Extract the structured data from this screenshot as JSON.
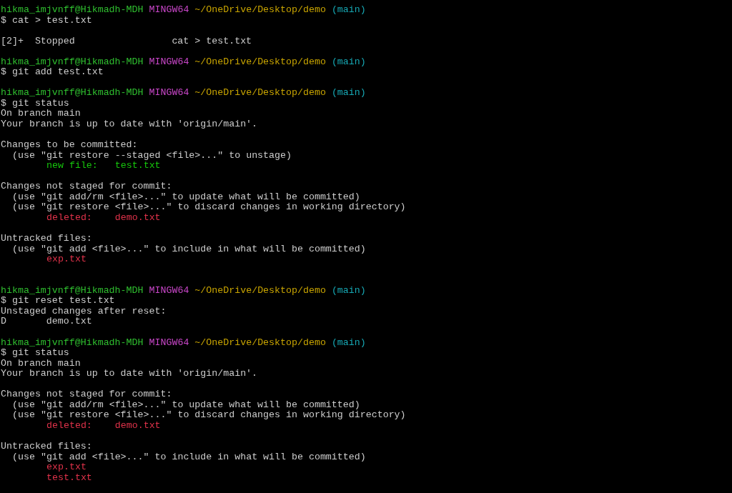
{
  "terminal": {
    "lines": [
      {
        "kind": "prompt",
        "user": "hikma_imjvnff@Hikmadh-MDH",
        "shell": "MINGW64",
        "path": "~/OneDrive/Desktop/demo",
        "branch": "(main)"
      },
      {
        "kind": "command",
        "text": "$ cat > test.txt"
      },
      {
        "kind": "blank"
      },
      {
        "kind": "text",
        "text": "[2]+  Stopped                 cat > test.txt"
      },
      {
        "kind": "blank"
      },
      {
        "kind": "prompt",
        "user": "hikma_imjvnff@Hikmadh-MDH",
        "shell": "MINGW64",
        "path": "~/OneDrive/Desktop/demo",
        "branch": "(main)"
      },
      {
        "kind": "command",
        "text": "$ git add test.txt"
      },
      {
        "kind": "blank"
      },
      {
        "kind": "prompt",
        "user": "hikma_imjvnff@Hikmadh-MDH",
        "shell": "MINGW64",
        "path": "~/OneDrive/Desktop/demo",
        "branch": "(main)"
      },
      {
        "kind": "command",
        "text": "$ git status"
      },
      {
        "kind": "text",
        "text": "On branch main"
      },
      {
        "kind": "text",
        "text": "Your branch is up to date with 'origin/main'."
      },
      {
        "kind": "blank"
      },
      {
        "kind": "text",
        "text": "Changes to be committed:"
      },
      {
        "kind": "hint",
        "text": "(use \"git restore --staged <file>...\" to unstage)"
      },
      {
        "kind": "entry",
        "text": "new file:   test.txt",
        "color": "#16c60c"
      },
      {
        "kind": "blank"
      },
      {
        "kind": "text",
        "text": "Changes not staged for commit:"
      },
      {
        "kind": "hint",
        "text": "(use \"git add/rm <file>...\" to update what will be committed)"
      },
      {
        "kind": "hint",
        "text": "(use \"git restore <file>...\" to discard changes in working directory)"
      },
      {
        "kind": "entry",
        "text": "deleted:    demo.txt",
        "color": "#e0324a"
      },
      {
        "kind": "blank"
      },
      {
        "kind": "text",
        "text": "Untracked files:"
      },
      {
        "kind": "hint",
        "text": "(use \"git add <file>...\" to include in what will be committed)"
      },
      {
        "kind": "entry",
        "text": "exp.txt",
        "color": "#e0324a"
      },
      {
        "kind": "blank"
      },
      {
        "kind": "blank"
      },
      {
        "kind": "prompt",
        "user": "hikma_imjvnff@Hikmadh-MDH",
        "shell": "MINGW64",
        "path": "~/OneDrive/Desktop/demo",
        "branch": "(main)"
      },
      {
        "kind": "command",
        "text": "$ git reset test.txt"
      },
      {
        "kind": "text",
        "text": "Unstaged changes after reset:"
      },
      {
        "kind": "text",
        "text": "D       demo.txt"
      },
      {
        "kind": "blank"
      },
      {
        "kind": "prompt",
        "user": "hikma_imjvnff@Hikmadh-MDH",
        "shell": "MINGW64",
        "path": "~/OneDrive/Desktop/demo",
        "branch": "(main)"
      },
      {
        "kind": "command",
        "text": "$ git status"
      },
      {
        "kind": "text",
        "text": "On branch main"
      },
      {
        "kind": "text",
        "text": "Your branch is up to date with 'origin/main'."
      },
      {
        "kind": "blank"
      },
      {
        "kind": "text",
        "text": "Changes not staged for commit:"
      },
      {
        "kind": "hint",
        "text": "(use \"git add/rm <file>...\" to update what will be committed)"
      },
      {
        "kind": "hint",
        "text": "(use \"git restore <file>...\" to discard changes in working directory)"
      },
      {
        "kind": "entry",
        "text": "deleted:    demo.txt",
        "color": "#e0324a"
      },
      {
        "kind": "blank"
      },
      {
        "kind": "text",
        "text": "Untracked files:"
      },
      {
        "kind": "hint",
        "text": "(use \"git add <file>...\" to include in what will be committed)"
      },
      {
        "kind": "entry",
        "text": "exp.txt",
        "color": "#e0324a"
      },
      {
        "kind": "entry",
        "text": "test.txt",
        "color": "#e0324a"
      }
    ]
  }
}
